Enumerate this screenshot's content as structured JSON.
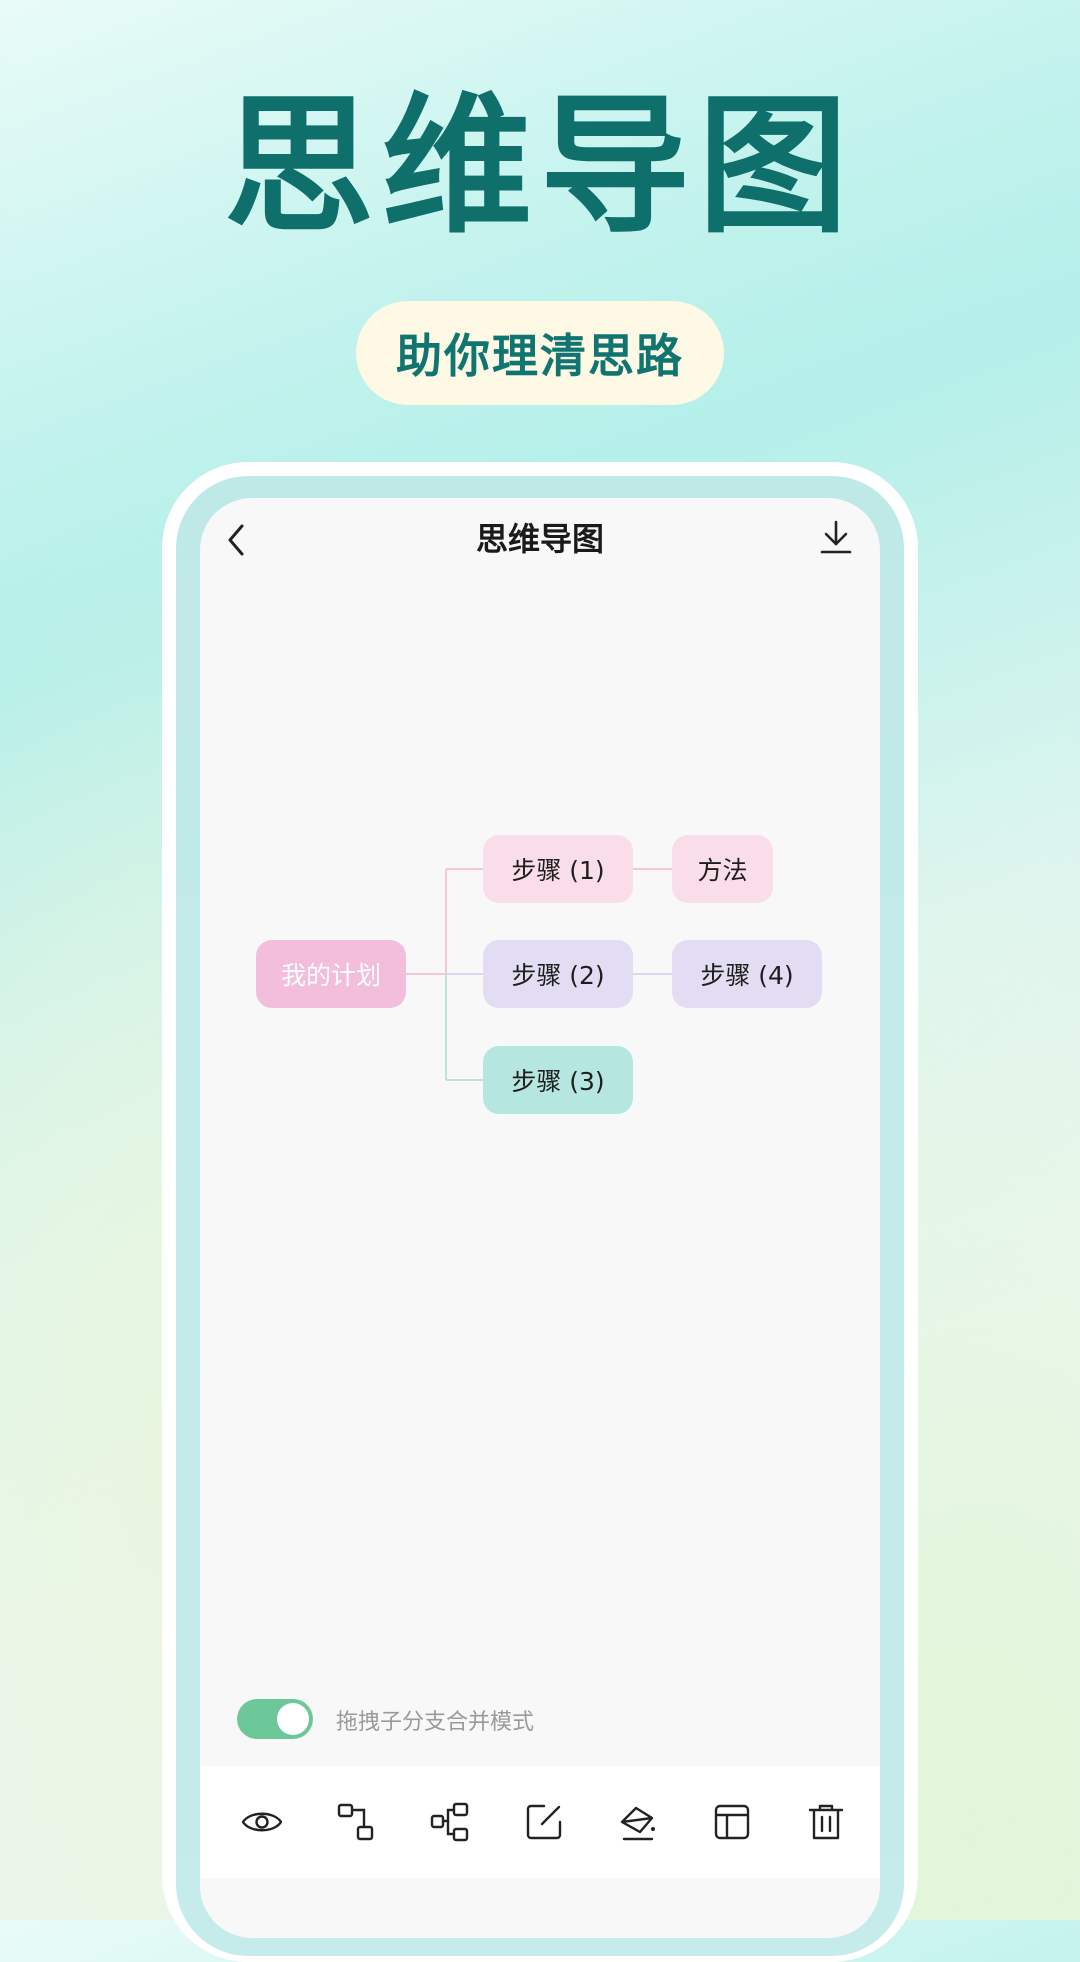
{
  "headline": "思维导图",
  "subtitle": "助你理清思路",
  "screen": {
    "title": "思维导图",
    "back_icon": "chevron-left-icon",
    "download_icon": "download-icon"
  },
  "mindmap": {
    "root": "我的计划",
    "step1": "步骤 (1)",
    "method": "方法",
    "step2": "步骤 (2)",
    "step4": "步骤 (4)",
    "step3": "步骤 (3)"
  },
  "toggle": {
    "on": true,
    "label": "拖拽子分支合并模式",
    "color": "#6cc898"
  },
  "toolbar": {
    "icons": [
      "eye-icon",
      "add-child-node-icon",
      "add-sibling-node-icon",
      "edit-icon",
      "erase-icon",
      "layout-icon",
      "delete-icon"
    ]
  },
  "colors": {
    "headline": "#0e6f6b",
    "root_node": "#f3bedb",
    "pink_node": "#f9dde9",
    "purple_node": "#e2ddf3",
    "teal_node": "#b5e6df"
  }
}
